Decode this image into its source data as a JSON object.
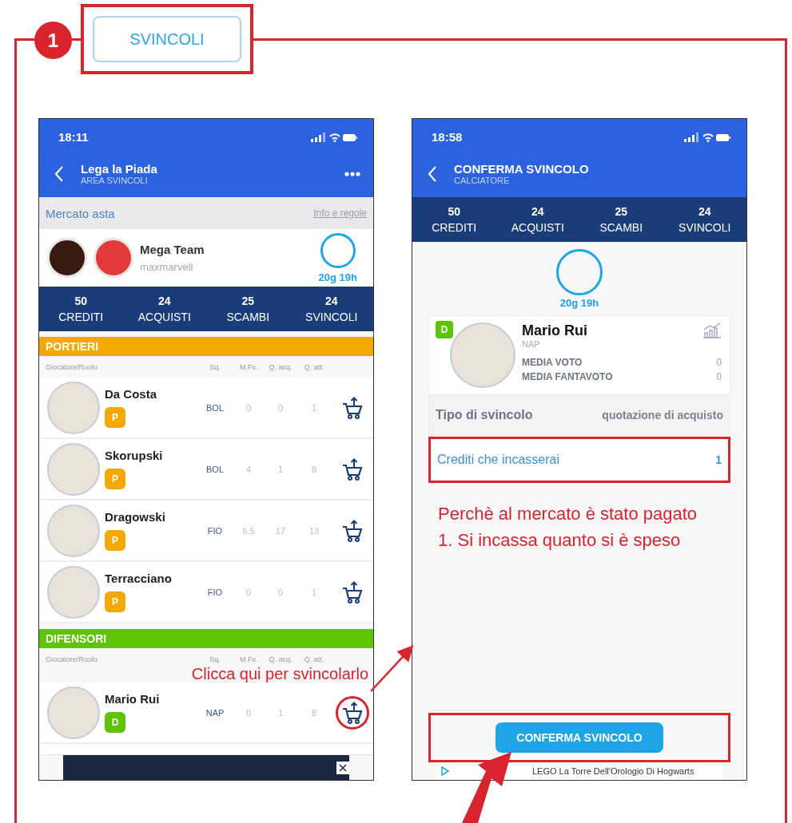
{
  "step": {
    "number": "1",
    "button": "SVINCOLI"
  },
  "left_screen": {
    "time": "18:11",
    "title": "Lega la Piada",
    "subtitle": "AREA SVINCOLI",
    "section": "Mercato asta",
    "section_link": "Info e regole",
    "team": {
      "name": "Mega Team",
      "owner": "maxmarvell",
      "timer": "20g 19h"
    },
    "stats": [
      {
        "value": "50",
        "label": "CREDITI"
      },
      {
        "value": "24",
        "label": "ACQUISTI"
      },
      {
        "value": "25",
        "label": "SCAMBI"
      },
      {
        "value": "24",
        "label": "SVINCOLI"
      }
    ],
    "groups": [
      {
        "title": "PORTIERI",
        "color": "#f5a800",
        "columns": [
          "Giocatore/Ruolo",
          "Sq.",
          "M.Fv.",
          "Q. acq.",
          "Q. att."
        ],
        "players": [
          {
            "name": "Da Costa",
            "role": "P",
            "team": "BOL",
            "mfv": "0",
            "qacq": "0",
            "qatt": "1",
            "highlighted": false
          },
          {
            "name": "Skorupski",
            "role": "P",
            "team": "BOL",
            "mfv": "4",
            "qacq": "1",
            "qatt": "8",
            "highlighted": false
          },
          {
            "name": "Dragowski",
            "role": "P",
            "team": "FIO",
            "mfv": "6.5",
            "qacq": "17",
            "qatt": "13",
            "highlighted": false
          },
          {
            "name": "Terracciano",
            "role": "P",
            "team": "FIO",
            "mfv": "0",
            "qacq": "0",
            "qatt": "1",
            "highlighted": false
          }
        ]
      },
      {
        "title": "DIFENSORI",
        "color": "#5cc400",
        "columns": [
          "Giocatore/Ruolo",
          "Sq.",
          "M.Fv.",
          "Q. acq.",
          "Q. att."
        ],
        "players": [
          {
            "name": "Mario Rui",
            "role": "D",
            "team": "NAP",
            "mfv": "0",
            "qacq": "1",
            "qatt": "8",
            "highlighted": true
          }
        ]
      }
    ],
    "annotation": "Clicca qui per svincolarlo"
  },
  "right_screen": {
    "time": "18:58",
    "title": "CONFERMA SVINCOLO",
    "subtitle": "CALCIATORE",
    "stats": [
      {
        "value": "50",
        "label": "CREDITI"
      },
      {
        "value": "24",
        "label": "ACQUISTI"
      },
      {
        "value": "25",
        "label": "SCAMBI"
      },
      {
        "value": "24",
        "label": "SVINCOLI"
      }
    ],
    "timer": "20g 19h",
    "player": {
      "role": "D",
      "name": "Mario Rui",
      "team": "NAP",
      "stats": [
        {
          "label": "MEDIA VOTO",
          "value": "0"
        },
        {
          "label": "MEDIA FANTAVOTO",
          "value": "0"
        }
      ]
    },
    "rows": [
      {
        "label": "Tipo di svincolo",
        "value": "quotazione di acquisto",
        "highlighted": false
      },
      {
        "label": "Crediti che incasserai",
        "value": "1",
        "highlighted": true
      }
    ],
    "annotation": [
      "Perchè al mercato è stato pagato",
      "1. Si incassa quanto si è speso"
    ],
    "button": "CONFERMA SVINCOLO",
    "ad_text": "LEGO La Torre Dell'Orologio Di Hogwarts"
  }
}
